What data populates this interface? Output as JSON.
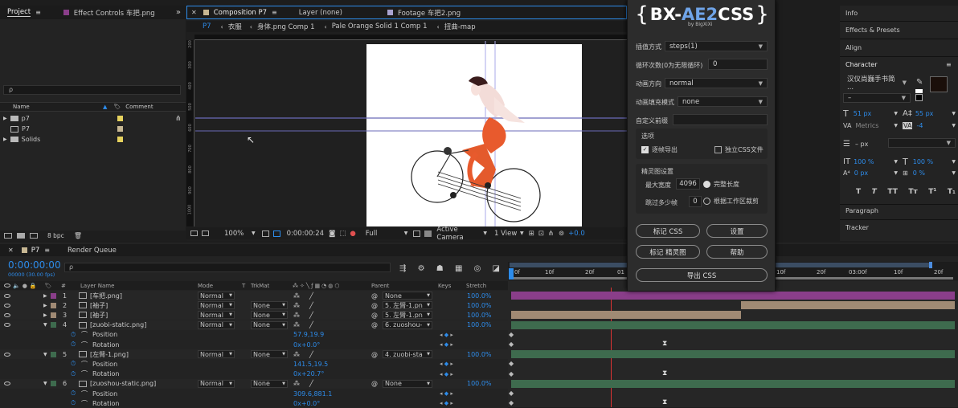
{
  "project": {
    "tabs": [
      "Project",
      "Effect Controls 车把.png"
    ],
    "more": "»",
    "search_placeholder": "ρ",
    "columns": {
      "name": "Name",
      "comment": "Comment"
    },
    "items": [
      "p7",
      "P7",
      "Solids"
    ],
    "bpc": "8 bpc"
  },
  "composition": {
    "tab": "Composition P7",
    "other_tabs": [
      "Layer (none)",
      "Footage 车把2.png"
    ],
    "breadcrumbs": [
      "P7",
      "衣服",
      "身体.png Comp 1",
      "Pale Orange Solid 1 Comp 1",
      "扭曲-map"
    ],
    "ruler": [
      "200",
      "300",
      "400",
      "500",
      "600",
      "700",
      "800",
      "900",
      "1000"
    ],
    "footer": {
      "zoom": "100%",
      "time": "0:00:00:24",
      "resolution": "Full",
      "camera": "Active Camera",
      "view": "1 View",
      "offset": "+0.0"
    }
  },
  "plugin": {
    "logo_prefix": "BX-",
    "logo_main": "AE2",
    "logo_suffix": "CSS",
    "logo_sub": "by BigXiXi",
    "fields": [
      {
        "label": "插值方式",
        "value": "steps(1)",
        "kind": "select"
      },
      {
        "label": "循环次数(0为无限循环)",
        "value": "0",
        "kind": "input"
      },
      {
        "label": "动画方向",
        "value": "normal",
        "kind": "select"
      },
      {
        "label": "动画填充模式",
        "value": "none",
        "kind": "select"
      },
      {
        "label": "自定义前缀",
        "value": "",
        "kind": "input"
      }
    ],
    "options_title": "选项",
    "opt_frame_export": "逐帧导出",
    "opt_separate_css": "独立CSS文件",
    "sprite_title": "精灵图设置",
    "max_width_label": "最大宽度",
    "max_width_value": "4096",
    "radio_full": "完整长度",
    "skip_label": "跳过多少帧",
    "skip_value": "0",
    "radio_work": "根据工作区裁剪",
    "buttons": [
      "标记 CSS",
      "设置",
      "标记 精灵图",
      "帮助",
      "导出 CSS"
    ]
  },
  "right": {
    "top": [
      "Info",
      "Effects & Presets",
      "Align"
    ],
    "character": "Character",
    "font": "汉仪尚巍手书简 ...",
    "style": "–",
    "size": "51 px",
    "leading": "55 px",
    "metrics": "Metrics",
    "tracking": "-4",
    "stroke": "– px",
    "vscale": "100 %",
    "hscale": "100 %",
    "baseline": "0 px",
    "tsume": "0 %",
    "glyphs": [
      "T",
      "T",
      "TT",
      "Tт",
      "T¹",
      "T₁"
    ],
    "bottom": [
      "Paragraph",
      "Tracker"
    ]
  },
  "timeline": {
    "tabs": [
      "P7",
      "Render Queue"
    ],
    "timecode": "0:00:00:00",
    "fps": "00000 (30.00 fps)",
    "cols": {
      "num": "#",
      "name": "Layer Name",
      "mode": "Mode",
      "t": "T",
      "trk": "TrkMat",
      "parent": "Parent",
      "keys": "Keys",
      "stretch": "Stretch"
    },
    "ruler": [
      "0f",
      "10f",
      "20f",
      "01",
      "10f",
      "20f",
      "03:00f",
      "10f",
      "20f"
    ],
    "rows": [
      {
        "type": "layer",
        "num": "1",
        "name": "[车把.png]",
        "mode": "Normal",
        "trk": "",
        "parent": "None",
        "stretch": "100.0%",
        "color": "#8a3e8a"
      },
      {
        "type": "layer",
        "num": "2",
        "name": "[袖子]",
        "mode": "Normal",
        "trk": "None",
        "parent": "5. 左臂-1.pn",
        "stretch": "100.0%",
        "color": "#a08a74"
      },
      {
        "type": "layer",
        "num": "3",
        "name": "[袖子]",
        "mode": "Normal",
        "trk": "None",
        "parent": "5. 左臂-1.pn",
        "stretch": "100.0%",
        "color": "#a08a74"
      },
      {
        "type": "layer",
        "num": "4",
        "name": "[zuobi-static.png]",
        "mode": "Normal",
        "trk": "None",
        "parent": "6. zuoshou-",
        "stretch": "100.0%",
        "color": "#3e6b4e"
      },
      {
        "type": "prop",
        "name": "Position",
        "value": "57.9,19.9"
      },
      {
        "type": "prop",
        "name": "Rotation",
        "value": "0x+0.0°"
      },
      {
        "type": "layer",
        "num": "5",
        "name": "[左臂-1.png]",
        "mode": "Normal",
        "trk": "None",
        "parent": "4. zuobi-sta",
        "stretch": "100.0%",
        "color": "#3e6b4e"
      },
      {
        "type": "prop",
        "name": "Position",
        "value": "141.5,19.5"
      },
      {
        "type": "prop",
        "name": "Rotation",
        "value": "0x+20.7°"
      },
      {
        "type": "layer",
        "num": "6",
        "name": "[zuoshou-static.png]",
        "mode": "Normal",
        "trk": "None",
        "parent": "None",
        "stretch": "100.0%",
        "color": "#3e6b4e"
      },
      {
        "type": "prop",
        "name": "Position",
        "value": "309.6,881.1"
      },
      {
        "type": "prop",
        "name": "Rotation",
        "value": "0x+0.0°"
      }
    ]
  },
  "colors": {
    "accent": "#2d8ceb",
    "panel": "#232323",
    "dark": "#1b1b1b"
  }
}
